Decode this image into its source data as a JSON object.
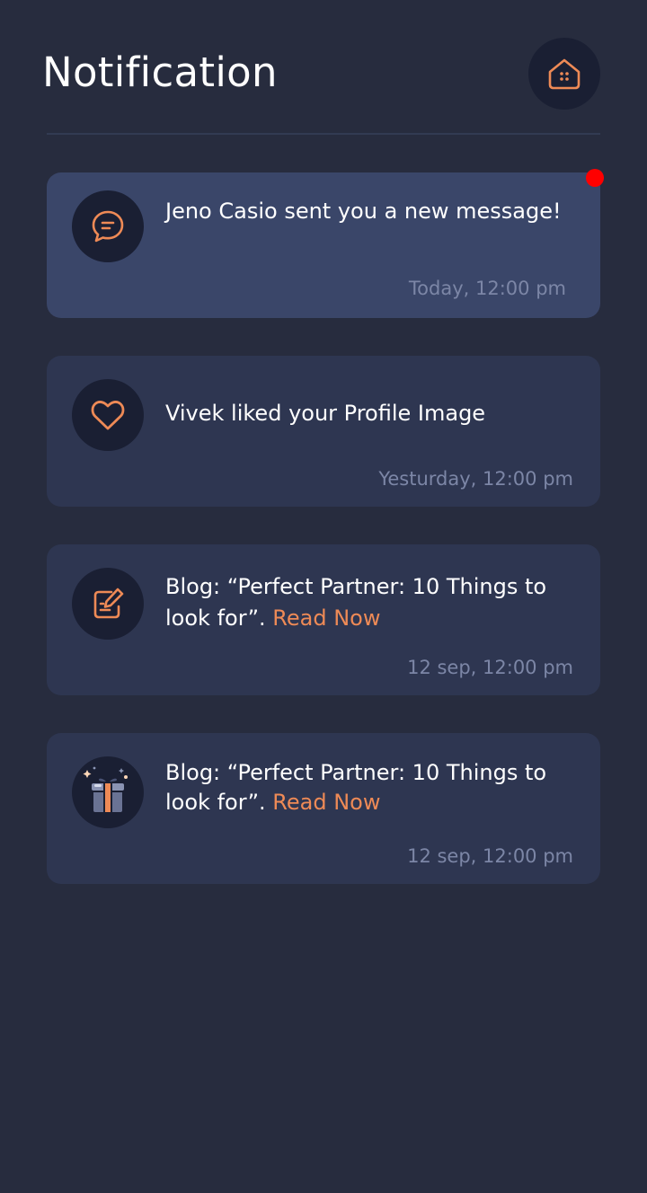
{
  "header": {
    "title": "Notification",
    "home_icon": "home-icon"
  },
  "colors": {
    "background": "#272c3e",
    "card": "#2e3651",
    "card_unread": "#3a4669",
    "accent": "#ee8a56",
    "unread_dot": "#ff0000"
  },
  "notifications": [
    {
      "icon": "chat-bubble-icon",
      "text": "Jeno Casio sent you a new message!",
      "time": "Today, 12:00 pm",
      "unread": true
    },
    {
      "icon": "heart-icon",
      "text": "Vivek liked your Profile Image",
      "time": "Yesturday, 12:00 pm",
      "unread": false
    },
    {
      "icon": "edit-note-icon",
      "text": "Blog: “Perfect Partner: 10 Things to look for”.",
      "link": "Read Now",
      "time": "12 sep, 12:00 pm",
      "unread": false
    },
    {
      "icon": "gift-icon",
      "text": "Blog: “Perfect Partner: 10 Things to look for”.",
      "link": "Read Now",
      "time": "12 sep, 12:00 pm",
      "unread": false
    }
  ]
}
